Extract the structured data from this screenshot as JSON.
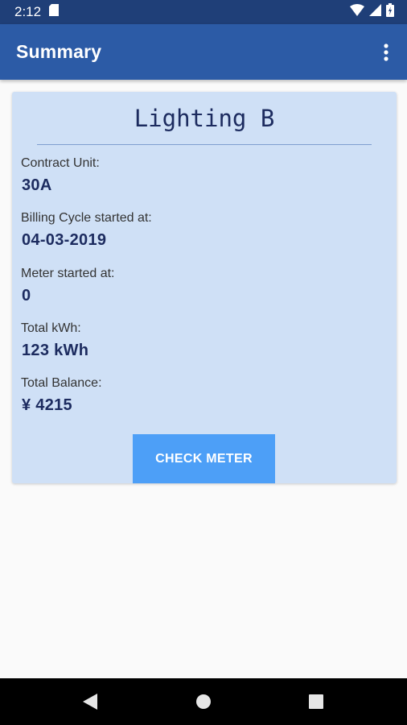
{
  "status_bar": {
    "time": "2:12",
    "icons": [
      "sd-card-icon",
      "wifi-icon",
      "signal-icon",
      "battery-icon"
    ]
  },
  "app_bar": {
    "title": "Summary",
    "menu_icon": "overflow-menu-icon"
  },
  "card": {
    "title": "Lighting B",
    "fields": [
      {
        "label": "Contract Unit:",
        "value": "30A"
      },
      {
        "label": "Billing Cycle started at:",
        "value": "04-03-2019"
      },
      {
        "label": "Meter started at:",
        "value": "0"
      },
      {
        "label": "Total kWh:",
        "value": "123 kWh"
      },
      {
        "label": "Total Balance:",
        "value": "¥ 4215"
      }
    ],
    "button_label": "CHECK METER"
  },
  "nav_bar": {
    "icons": [
      "back-icon",
      "home-icon",
      "recents-icon"
    ]
  },
  "colors": {
    "status_bar": "#1f3f78",
    "app_bar": "#2c5ba6",
    "card_background": "#cfe0f6",
    "button": "#4d9ff7",
    "value_text": "#1c2b5f"
  }
}
